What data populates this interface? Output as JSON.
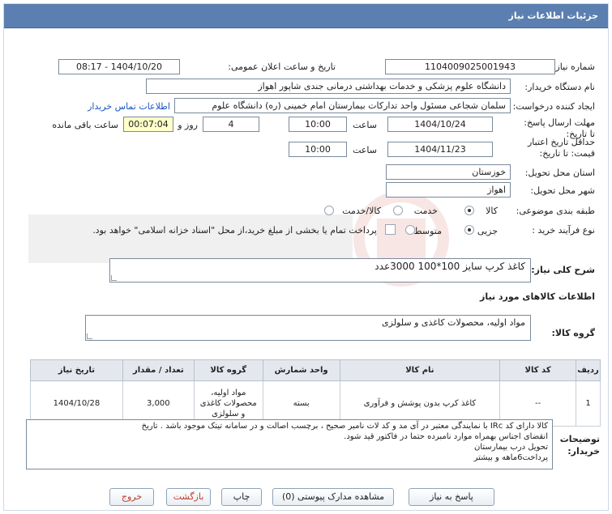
{
  "header": {
    "title": "جزئیات اطلاعات نیاز"
  },
  "fields": {
    "need_number_label": "شماره نیاز:",
    "need_number": "1104009025001943",
    "announce_label": "تاریخ و ساعت اعلان عمومی:",
    "announce_value": "1404/10/20 - 08:17",
    "buyer_label": "نام دستگاه خریدار:",
    "buyer_value": "دانشگاه علوم پزشکی و خدمات بهداشتی درمانی جندی شاپور اهواز",
    "creator_label": "ایجاد کننده درخواست:",
    "creator_value": "سلمان شجاعی مسئول واحد تدارکات بیمارستان امام خمینی (ره) دانشگاه علوم",
    "contact_link": "اطلاعات تماس خریدار",
    "deadline_label": "مهلت ارسال پاسخ: تا تاریخ:",
    "deadline_date": "1404/10/24",
    "time_label": "ساعت",
    "deadline_time": "10:00",
    "days_value": "4",
    "days_label": "روز و",
    "remaining_time": "00:07:04",
    "remaining_label": "ساعت باقی مانده",
    "validity_label": "حداقل تاریخ اعتبار قیمت: تا تاریخ:",
    "validity_date": "1404/11/23",
    "validity_time": "10:00",
    "province_label": "استان محل تحویل:",
    "province_value": "خوزستان",
    "city_label": "شهر محل تحویل:",
    "city_value": "اهواز",
    "category_label": "طبقه بندی موضوعی:",
    "category_options": [
      "کالا",
      "خدمت",
      "کالا/خدمت"
    ],
    "process_label": "نوع فرآیند خرید :",
    "process_options": [
      "جزیی",
      "متوسط"
    ],
    "process_note": "پرداخت تمام یا بخشی از مبلغ خرید،از محل \"اسناد خزانه اسلامی\" خواهد بود."
  },
  "summary": {
    "label": "شرح کلی نیاز:",
    "value": "کاغذ کرپ سایز 100*100      3000عدد"
  },
  "goods_info": {
    "heading": "اطلاعات کالاهای مورد نیاز"
  },
  "goods_group": {
    "label": "گروه کالا:",
    "value": "مواد اولیه، محصولات کاغذی و سلولزی"
  },
  "table": {
    "headers": [
      "ردیف",
      "کد کالا",
      "نام کالا",
      "واحد شمارش",
      "گروه کالا",
      "تعداد / مقدار",
      "تاریخ نیاز"
    ],
    "rows": [
      {
        "index": "1",
        "code": "--",
        "name": "کاغذ کرپ بدون پوشش و فرآوری",
        "unit": "بسته",
        "group": "مواد اولیه، محصولات کاغذی و سلولزی",
        "qty": "3,000",
        "date": "1404/10/28"
      }
    ]
  },
  "buyer_notes": {
    "label": "توضیحات خریدار:",
    "lines": [
      "کالا دارای کد IRc با نمایندگی معتبر در آی مد و کد لات نامبر صحیح ، برچسب اصالت و در سامانه تیتک موجود باشد . تاریخ",
      "انقضای اجناس بهمراه موارد نامبرده حتما در فاکتور قید شود.",
      "تحویل درب بیمارستان",
      "پرداخت6ماهه و بیشتر"
    ]
  },
  "buttons": {
    "reply": "پاسخ به نیاز",
    "attachments": "مشاهده مدارک پیوستی (0)",
    "print": "چاپ",
    "back": "بازگشت",
    "exit": "خروج"
  },
  "colors": {
    "header": "#5b7fb0",
    "link": "#1a55c0",
    "timer_bg": "#ffffc8"
  }
}
